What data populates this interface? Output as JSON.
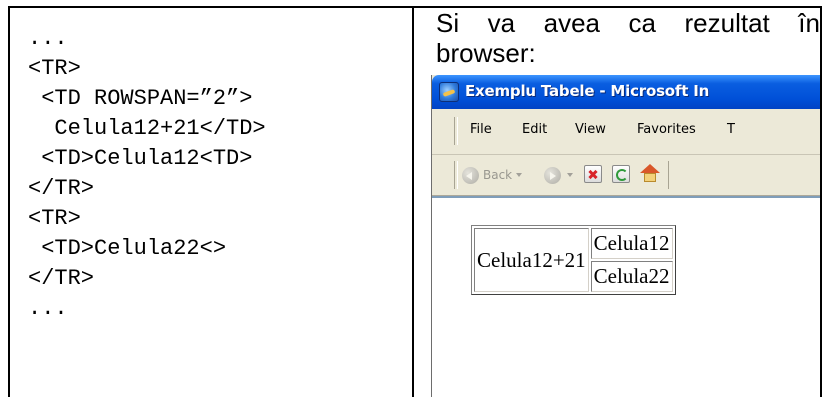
{
  "code_lines": [
    "...",
    "<TR>",
    " <TD ROWSPAN=”2”>",
    "  Celula12+21</TD>",
    " <TD>Celula12<TD>",
    "</TR>",
    "<TR>",
    " <TD>Celula22<>",
    "</TR>",
    "..."
  ],
  "description": {
    "line1_words": [
      "Si",
      "va",
      "avea",
      "ca",
      "rezultat",
      "în"
    ],
    "line2": "browser:"
  },
  "browser": {
    "title": "Exemplu Tabele - Microsoft In",
    "menu": [
      "File",
      "Edit",
      "View",
      "Favorites",
      "T"
    ],
    "back_label": "Back",
    "table": {
      "rowspan_cell": "Celula12+21",
      "cell_r1": "Celula12",
      "cell_r2": "Celula22"
    }
  }
}
